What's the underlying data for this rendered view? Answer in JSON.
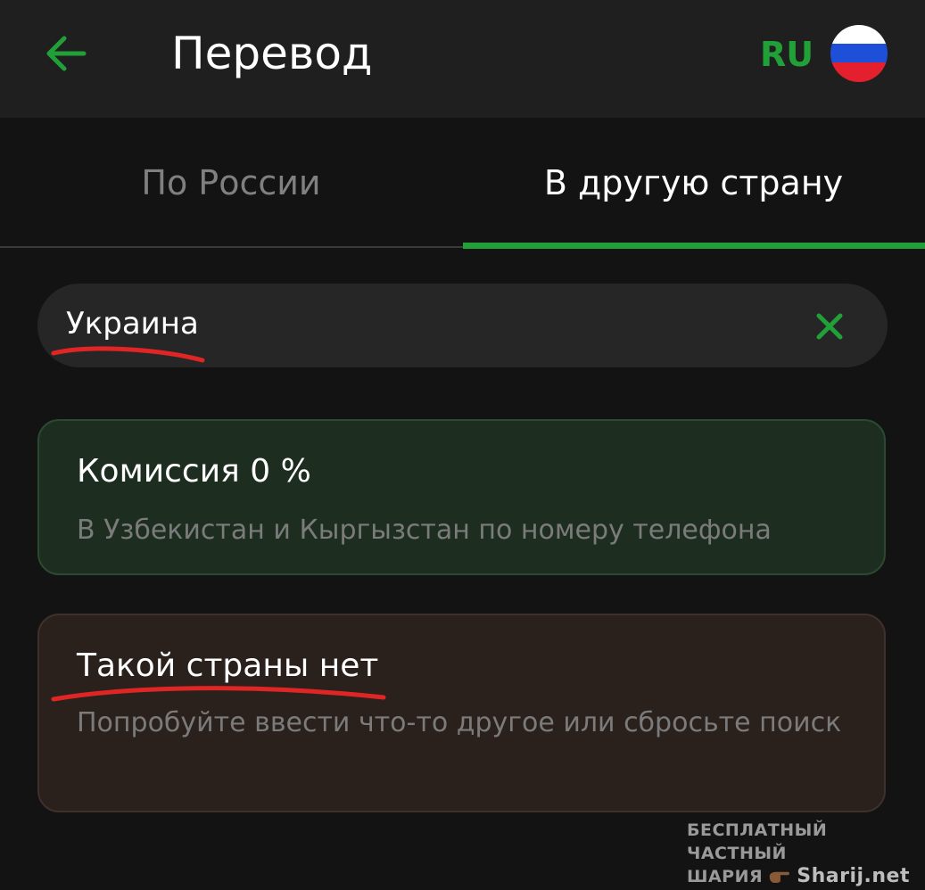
{
  "header": {
    "title": "Перевод",
    "lang_code": "RU",
    "back_icon": "arrow-left-icon",
    "flag_icon": "russia-flag-icon",
    "accent_color": "#21a038"
  },
  "tabs": [
    {
      "label": "По России",
      "active": false
    },
    {
      "label": "В другую страну",
      "active": true
    }
  ],
  "search": {
    "value": "Украина",
    "clear_icon": "close-icon"
  },
  "promo_card": {
    "title": "Комиссия 0 %",
    "subtitle": "В Узбекистан и Кыргызстан по номеру телефона"
  },
  "empty_state": {
    "title": "Такой страны нет",
    "subtitle": "Попробуйте ввести что-то другое или сбросьте поиск"
  },
  "watermark": {
    "line1": "БЕСПЛАТНЫЙ ЧАСТНЫЙ",
    "line2_left": "ШАРИЯ",
    "line2_right": "Sharij.net"
  }
}
